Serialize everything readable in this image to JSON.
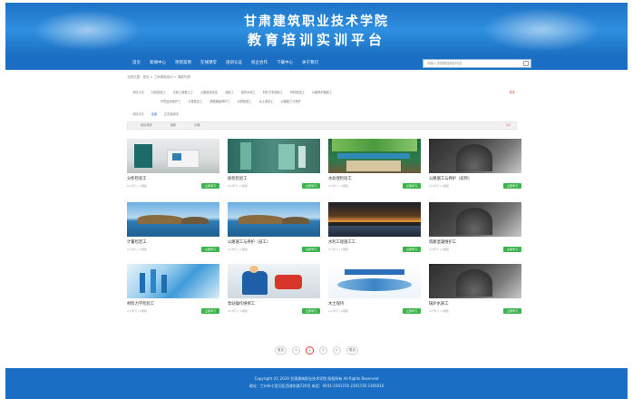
{
  "header": {
    "title_line1": "甘肃建筑职业技术学院",
    "title_line2": "教育培训实训平台"
  },
  "nav": {
    "items": [
      "首页",
      "新闻中心",
      "项目案例",
      "在线课堂",
      "培训认证",
      "校企合作",
      "下载中心",
      "关于我们"
    ],
    "search_placeholder": "请输入您想要搜索的内容"
  },
  "breadcrumb": "当前位置：首页 > 工种课程培训 > 课程列表",
  "filters": {
    "row1_label": "课程分类",
    "row1_options": [
      "分析检验工",
      "水利工程施工工",
      "公路检测评定",
      "测量工",
      "保护水利工",
      "材料力学检验工",
      "材料检验工",
      "公路养护路检工"
    ],
    "row1_more": "更多",
    "row2_options": [
      "环境监测保护工",
      "计量检定工",
      "道路路面养护工",
      "水质检验工",
      "水土保持工",
      "公路施工与养护"
    ],
    "row3_label": "课程状态",
    "row3_options": [
      "全部",
      "正在培训中"
    ]
  },
  "sort": {
    "items": [
      "综合排序",
      "最新",
      "价格"
    ],
    "page_indicator": "1/2"
  },
  "courses": [
    {
      "title": "分析检验工",
      "meta": "0人学习 | 0课程",
      "button": "立即学习"
    },
    {
      "title": "质检检验工",
      "meta": "0人学习 | 0课程",
      "button": "立即学习"
    },
    {
      "title": "水处理检验工",
      "meta": "0人学习 | 0课程",
      "button": "立即学习"
    },
    {
      "title": "公路施工与养护（技师）",
      "meta": "0人学习 | 0课程",
      "button": "立即学习"
    },
    {
      "title": "计量检定工",
      "meta": "0人学习 | 0课程",
      "button": "立即学习"
    },
    {
      "title": "公路施工与养护（技工）",
      "meta": "0人学习 | 0课程",
      "button": "立即学习"
    },
    {
      "title": "水利工程施工工",
      "meta": "0人学习 | 0课程",
      "button": "立即学习"
    },
    {
      "title": "筑路混凝维护工",
      "meta": "0人学习 | 0课程",
      "button": "立即学习"
    },
    {
      "title": "材料力学检验工",
      "meta": "0人学习 | 0课程",
      "button": "立即学习"
    },
    {
      "title": "泵站操作维修工",
      "meta": "0人学习 | 0课程",
      "button": "立即学习"
    },
    {
      "title": "水土保持",
      "meta": "0人学习 | 0课程",
      "button": "立即学习"
    },
    {
      "title": "锅炉水质工",
      "meta": "0人学习 | 0课程",
      "button": "立即学习"
    }
  ],
  "pagination": {
    "first": "首页",
    "prev": "<",
    "pages": [
      "1",
      "2"
    ],
    "next": ">",
    "last": "尾页",
    "current": "1"
  },
  "footer": {
    "line1": "Copyright (C) 2019 甘肃建筑职业技术学院 版权所有   All Rights Reserved",
    "line2": "地址：兰州市七里河区西津东路720号   电话：0931-2391150 2391720 2395010"
  }
}
